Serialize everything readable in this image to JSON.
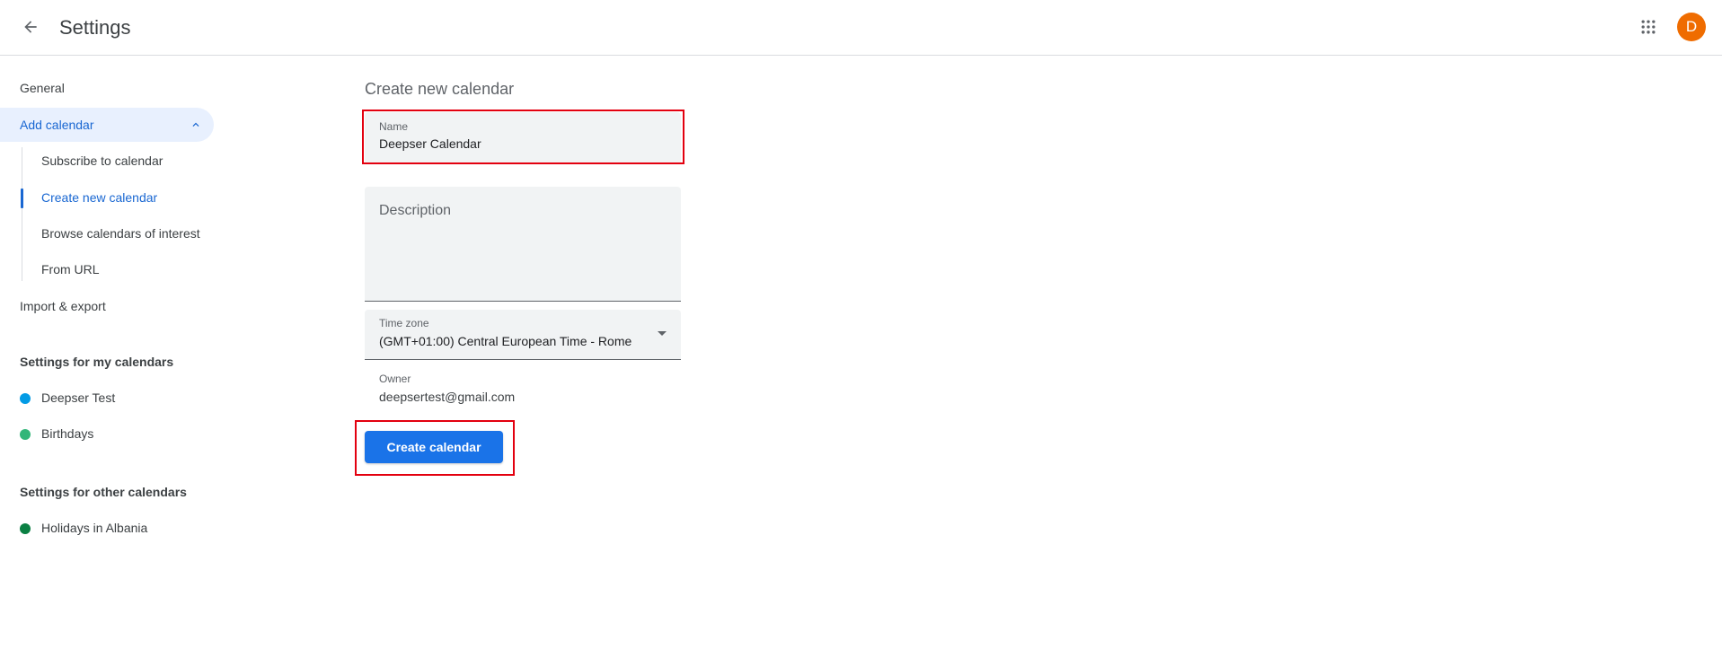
{
  "header": {
    "title": "Settings",
    "avatar_letter": "D",
    "avatar_color": "#ef6c00"
  },
  "sidebar": {
    "general": "General",
    "add_calendar": "Add calendar",
    "add_calendar_children": [
      "Subscribe to calendar",
      "Create new calendar",
      "Browse calendars of interest",
      "From URL"
    ],
    "import_export": "Import & export",
    "my_calendars_heading": "Settings for my calendars",
    "my_calendars": [
      {
        "label": "Deepser Test",
        "color": "#039be5"
      },
      {
        "label": "Birthdays",
        "color": "#33b679"
      }
    ],
    "other_calendars_heading": "Settings for other calendars",
    "other_calendars": [
      {
        "label": "Holidays in Albania",
        "color": "#0b8043"
      }
    ]
  },
  "form": {
    "title": "Create new calendar",
    "name_label": "Name",
    "name_value": "Deepser Calendar",
    "description_placeholder": "Description",
    "timezone_label": "Time zone",
    "timezone_value": "(GMT+01:00) Central European Time - Rome",
    "owner_label": "Owner",
    "owner_value": "deepsertest@gmail.com",
    "create_button": "Create calendar"
  },
  "colors": {
    "accent": "#1a73e8",
    "active_nav_bg": "#e8f0fe",
    "active_nav_text": "#1967d2",
    "highlight_box": "#e3000f"
  }
}
